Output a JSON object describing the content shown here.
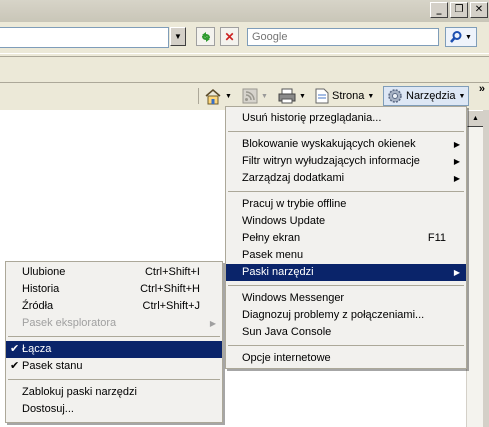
{
  "window": {
    "min": "_",
    "max": "❐",
    "close": "✕"
  },
  "address": {
    "value": ""
  },
  "search": {
    "placeholder": "Google"
  },
  "commandbar": {
    "page_label": "Strona",
    "tools_label": "Narzędzia",
    "chevron": "»"
  },
  "tools_menu": {
    "items": [
      {
        "label": "Usuń historię przeglądania..."
      },
      {
        "label": "Blokowanie wyskakujących okienek"
      },
      {
        "label": "Filtr witryn wyłudzających informacje"
      },
      {
        "label": "Zarządzaj dodatkami"
      },
      {
        "label": "Pracuj w trybie offline"
      },
      {
        "label": "Windows Update"
      },
      {
        "label": "Pełny ekran",
        "accel": "F11"
      },
      {
        "label": "Pasek menu"
      },
      {
        "label": "Paski narzędzi"
      },
      {
        "label": "Windows Messenger"
      },
      {
        "label": "Diagnozuj problemy z połączeniami..."
      },
      {
        "label": "Sun Java Console"
      },
      {
        "label": "Opcje internetowe"
      }
    ]
  },
  "toolbars_menu": {
    "items": [
      {
        "label": "Ulubione",
        "accel": "Ctrl+Shift+I"
      },
      {
        "label": "Historia",
        "accel": "Ctrl+Shift+H"
      },
      {
        "label": "Źródła",
        "accel": "Ctrl+Shift+J"
      },
      {
        "label": "Pasek eksploratora"
      },
      {
        "label": "Łącza"
      },
      {
        "label": "Pasek stanu"
      },
      {
        "label": "Zablokuj paski narzędzi"
      },
      {
        "label": "Dostosuj..."
      }
    ]
  }
}
